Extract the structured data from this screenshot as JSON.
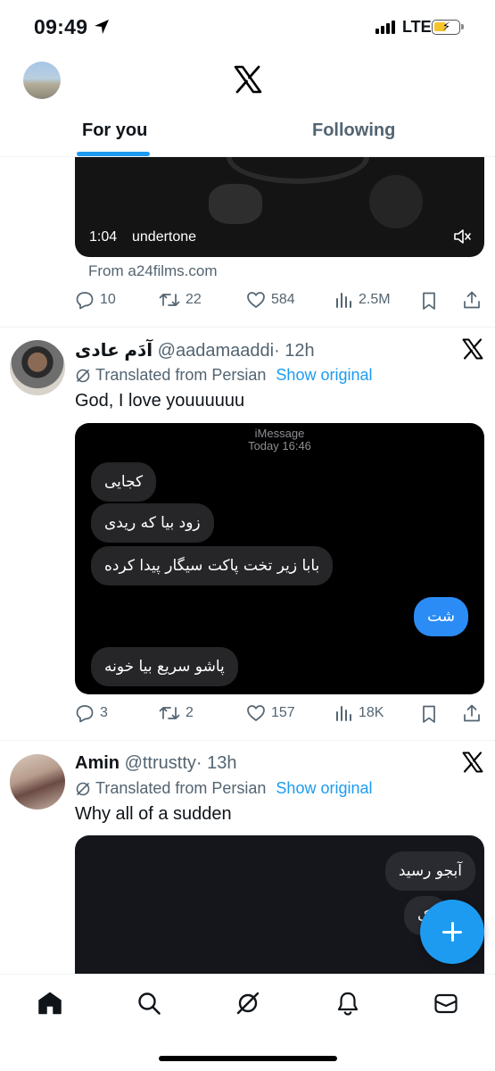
{
  "status_bar": {
    "time": "09:49",
    "network": "LTE",
    "icons": [
      "location-arrow-icon",
      "signal-icon",
      "battery-charging-icon"
    ]
  },
  "header": {
    "logo": "x-logo-icon",
    "tabs": [
      {
        "label": "For you",
        "active": true
      },
      {
        "label": "Following",
        "active": false
      }
    ]
  },
  "tweets": [
    {
      "video": {
        "time": "1:04",
        "title": "undertone"
      },
      "source": "From a24films.com",
      "actions": {
        "replies": "10",
        "reposts": "22",
        "likes": "584",
        "views": "2.5M"
      }
    },
    {
      "name": "آدَم عادی",
      "handle": "@aadamaaddi",
      "time": "· 12h",
      "translated_label": "Translated from Persian",
      "show_original": "Show original",
      "text": "God, I love youuuuuu",
      "imessage": {
        "header_line1": "iMessage",
        "header_line2": "Today 16:46",
        "messages": [
          {
            "text": "کجایی",
            "from_me": false
          },
          {
            "text": "زود بیا که ریدی",
            "from_me": false
          },
          {
            "text": "بابا زیر تخت پاکت سیگار پیدا کرده",
            "from_me": false
          },
          {
            "text": "شت",
            "from_me": true
          },
          {
            "text": "پاشو سریع بیا خونه",
            "from_me": false
          }
        ]
      },
      "actions": {
        "replies": "3",
        "reposts": "2",
        "likes": "157",
        "views": "18K"
      }
    },
    {
      "name": "Amin",
      "handle": "@ttrustty",
      "time": "· 13h",
      "translated_label": "Translated from Persian",
      "show_original": "Show original",
      "text": "Why all of a sudden",
      "imessage": {
        "messages": [
          {
            "text": "آبجو رسید",
            "from_me": false
          },
          {
            "text": "یک",
            "from_me": false
          }
        ]
      }
    }
  ],
  "colors": {
    "accent": "#1d9bf0",
    "text": "#0f1419",
    "muted": "#536471",
    "bubble_gray": "#262628",
    "bubble_blue": "#2b8cf6"
  },
  "bottom_nav": [
    "home-icon",
    "search-icon",
    "grok-icon",
    "notifications-bell-icon",
    "messages-envelope-icon"
  ]
}
